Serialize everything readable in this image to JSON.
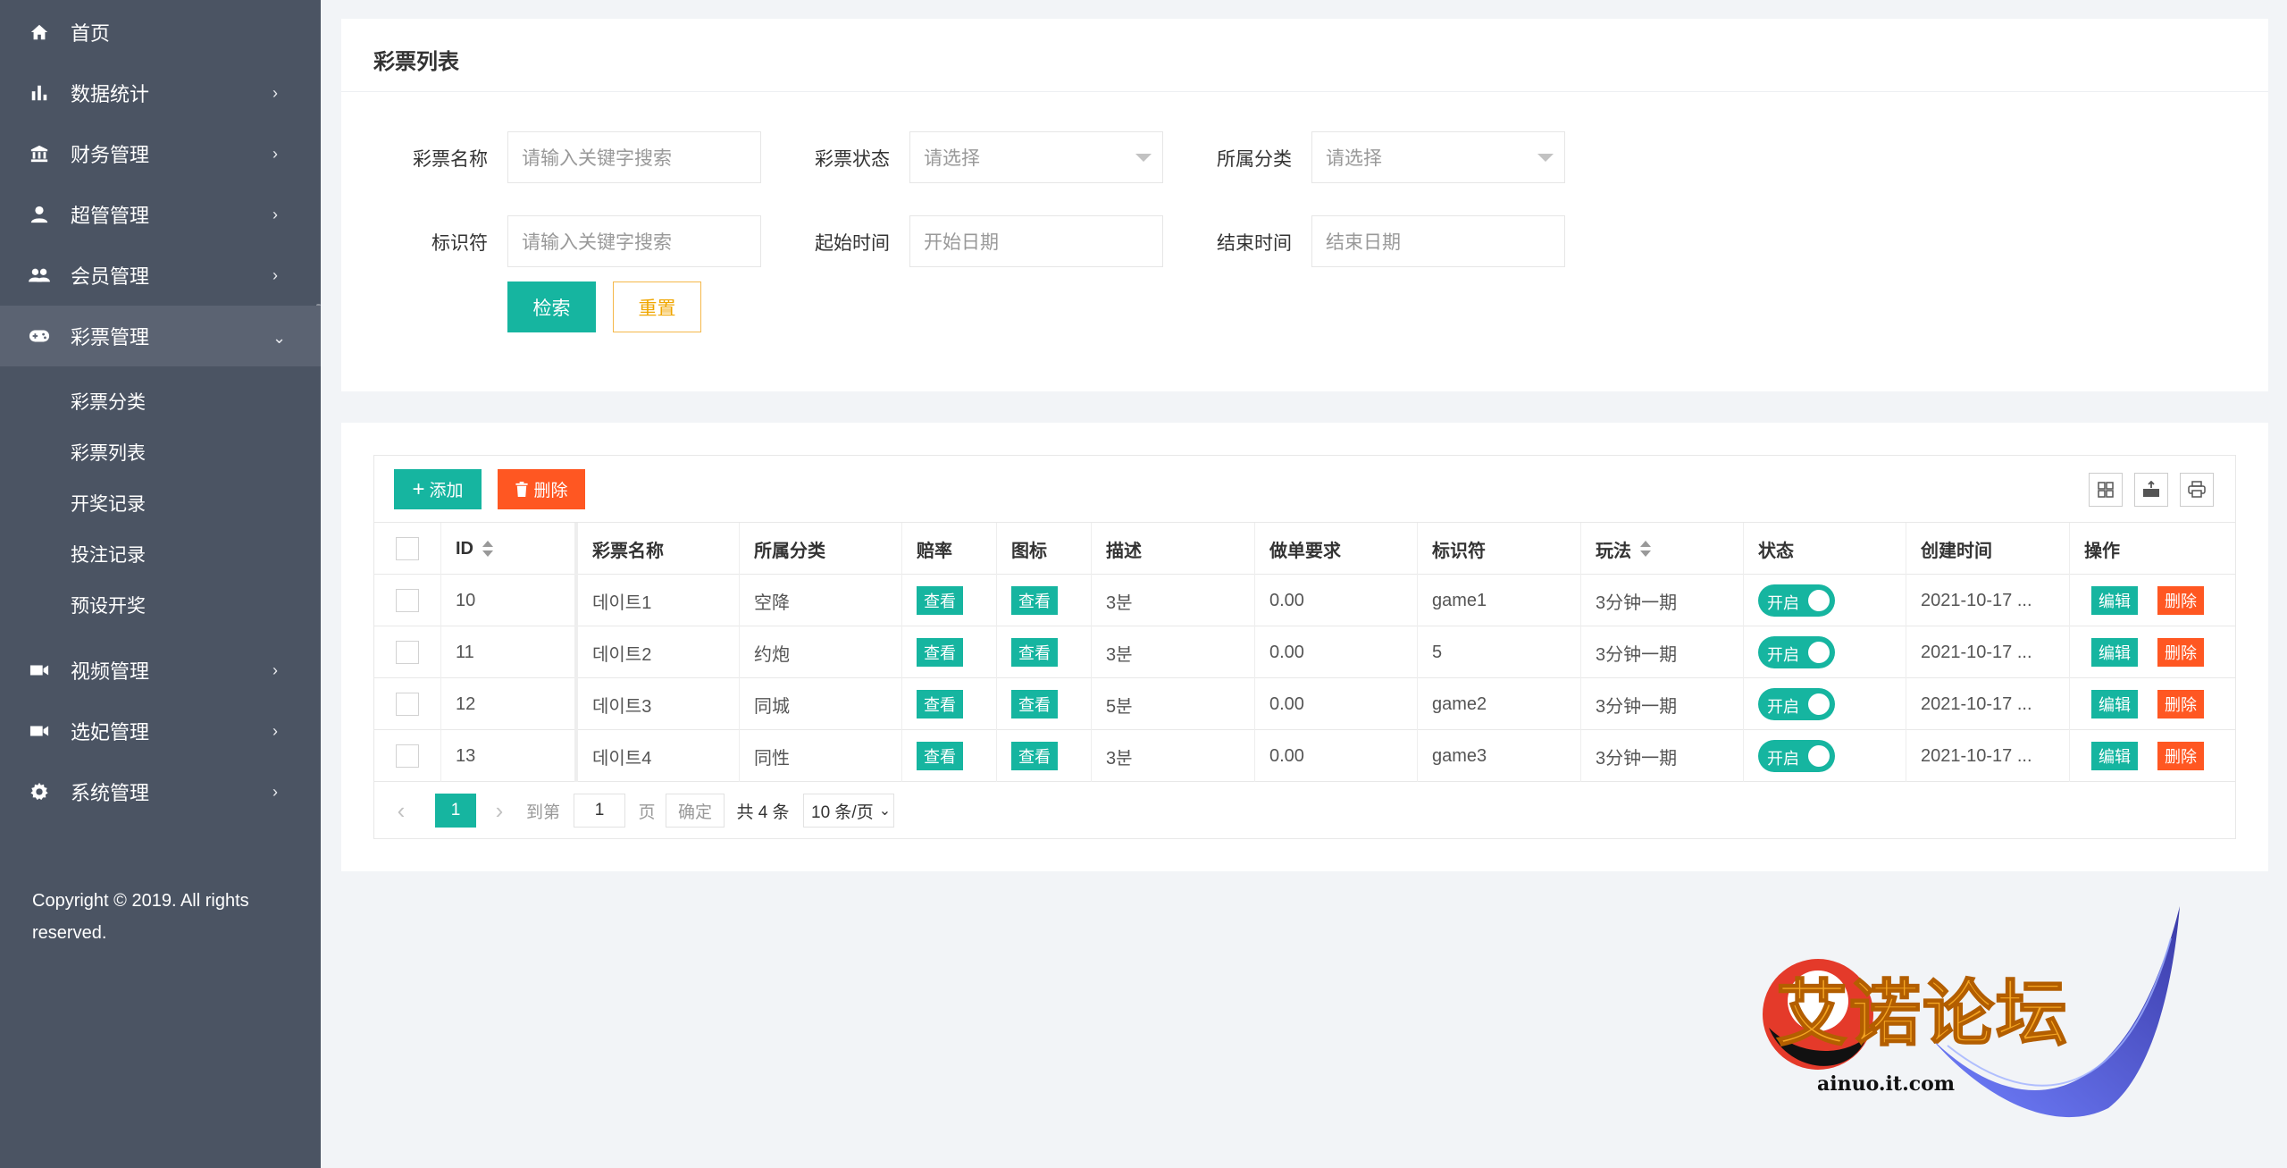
{
  "sidebar": {
    "items": [
      {
        "label": "首页",
        "icon": "home-icon",
        "has_arrow": false
      },
      {
        "label": "数据统计",
        "icon": "bar-chart-icon",
        "has_arrow": true
      },
      {
        "label": "财务管理",
        "icon": "bank-icon",
        "has_arrow": true
      },
      {
        "label": "超管管理",
        "icon": "user-icon",
        "has_arrow": true
      },
      {
        "label": "会员管理",
        "icon": "users-icon",
        "has_arrow": true
      },
      {
        "label": "彩票管理",
        "icon": "gamepad-icon",
        "has_arrow": true,
        "active": true
      },
      {
        "label": "视频管理",
        "icon": "video-icon",
        "has_arrow": true
      },
      {
        "label": "选妃管理",
        "icon": "video-icon",
        "has_arrow": true
      },
      {
        "label": "系统管理",
        "icon": "gear-icon",
        "has_arrow": true
      }
    ],
    "subitems": [
      "彩票分类",
      "彩票列表",
      "开奖记录",
      "投注记录",
      "预设开奖"
    ],
    "copyright": "Copyright © 2019. All rights reserved."
  },
  "filter": {
    "title": "彩票列表",
    "name_label": "彩票名称",
    "name_placeholder": "请输入关键字搜索",
    "status_label": "彩票状态",
    "status_placeholder": "请选择",
    "category_label": "所属分类",
    "category_placeholder": "请选择",
    "key_label": "标识符",
    "key_placeholder": "请输入关键字搜索",
    "start_label": "起始时间",
    "start_placeholder": "开始日期",
    "end_label": "结束时间",
    "end_placeholder": "结束日期",
    "search_button": "检索",
    "reset_button": "重置"
  },
  "toolbar": {
    "add_button": "添加",
    "delete_button": "删除"
  },
  "table": {
    "headers": [
      "ID",
      "彩票名称",
      "所属分类",
      "赔率",
      "图标",
      "描述",
      "做单要求",
      "标识符",
      "玩法",
      "状态",
      "创建时间",
      "操作"
    ],
    "view_label": "查看",
    "toggle_label": "开启",
    "edit_label": "编辑",
    "remove_label": "删除",
    "rows": [
      {
        "id": "10",
        "name": "데이트1",
        "category": "空降",
        "desc": "3분",
        "req": "0.00",
        "key": "game1",
        "play": "3分钟一期",
        "created": "2021-10-17 ..."
      },
      {
        "id": "11",
        "name": "데이트2",
        "category": "约炮",
        "desc": "3분",
        "req": "0.00",
        "key": "5",
        "play": "3分钟一期",
        "created": "2021-10-17 ..."
      },
      {
        "id": "12",
        "name": "데이트3",
        "category": "同城",
        "desc": "5분",
        "req": "0.00",
        "key": "game2",
        "play": "3分钟一期",
        "created": "2021-10-17 ..."
      },
      {
        "id": "13",
        "name": "데이트4",
        "category": "同性",
        "desc": "3분",
        "req": "0.00",
        "key": "game3",
        "play": "3分钟一期",
        "created": "2021-10-17 ..."
      }
    ]
  },
  "pager": {
    "current": "1",
    "goto_label": "到第",
    "goto_value": "1",
    "page_unit": "页",
    "confirm": "确定",
    "total": "共 4 条",
    "page_size": "10 条/页"
  },
  "watermark": {
    "text": "艾诺论坛",
    "url": "ainuo.it.com"
  }
}
